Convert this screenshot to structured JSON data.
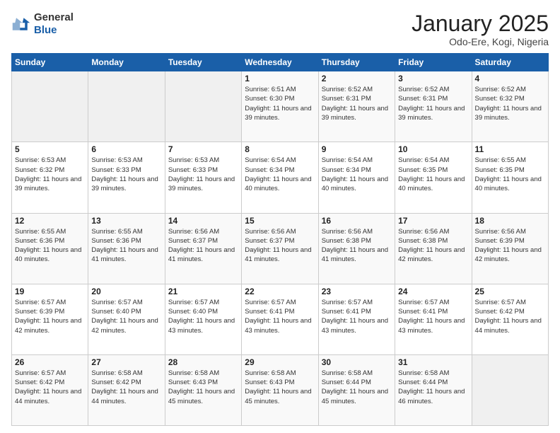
{
  "header": {
    "logo_general": "General",
    "logo_blue": "Blue",
    "month_title": "January 2025",
    "location": "Odo-Ere, Kogi, Nigeria"
  },
  "weekdays": [
    "Sunday",
    "Monday",
    "Tuesday",
    "Wednesday",
    "Thursday",
    "Friday",
    "Saturday"
  ],
  "weeks": [
    [
      {
        "day": "",
        "info": ""
      },
      {
        "day": "",
        "info": ""
      },
      {
        "day": "",
        "info": ""
      },
      {
        "day": "1",
        "info": "Sunrise: 6:51 AM\nSunset: 6:30 PM\nDaylight: 11 hours and 39 minutes."
      },
      {
        "day": "2",
        "info": "Sunrise: 6:52 AM\nSunset: 6:31 PM\nDaylight: 11 hours and 39 minutes."
      },
      {
        "day": "3",
        "info": "Sunrise: 6:52 AM\nSunset: 6:31 PM\nDaylight: 11 hours and 39 minutes."
      },
      {
        "day": "4",
        "info": "Sunrise: 6:52 AM\nSunset: 6:32 PM\nDaylight: 11 hours and 39 minutes."
      }
    ],
    [
      {
        "day": "5",
        "info": "Sunrise: 6:53 AM\nSunset: 6:32 PM\nDaylight: 11 hours and 39 minutes."
      },
      {
        "day": "6",
        "info": "Sunrise: 6:53 AM\nSunset: 6:33 PM\nDaylight: 11 hours and 39 minutes."
      },
      {
        "day": "7",
        "info": "Sunrise: 6:53 AM\nSunset: 6:33 PM\nDaylight: 11 hours and 39 minutes."
      },
      {
        "day": "8",
        "info": "Sunrise: 6:54 AM\nSunset: 6:34 PM\nDaylight: 11 hours and 40 minutes."
      },
      {
        "day": "9",
        "info": "Sunrise: 6:54 AM\nSunset: 6:34 PM\nDaylight: 11 hours and 40 minutes."
      },
      {
        "day": "10",
        "info": "Sunrise: 6:54 AM\nSunset: 6:35 PM\nDaylight: 11 hours and 40 minutes."
      },
      {
        "day": "11",
        "info": "Sunrise: 6:55 AM\nSunset: 6:35 PM\nDaylight: 11 hours and 40 minutes."
      }
    ],
    [
      {
        "day": "12",
        "info": "Sunrise: 6:55 AM\nSunset: 6:36 PM\nDaylight: 11 hours and 40 minutes."
      },
      {
        "day": "13",
        "info": "Sunrise: 6:55 AM\nSunset: 6:36 PM\nDaylight: 11 hours and 41 minutes."
      },
      {
        "day": "14",
        "info": "Sunrise: 6:56 AM\nSunset: 6:37 PM\nDaylight: 11 hours and 41 minutes."
      },
      {
        "day": "15",
        "info": "Sunrise: 6:56 AM\nSunset: 6:37 PM\nDaylight: 11 hours and 41 minutes."
      },
      {
        "day": "16",
        "info": "Sunrise: 6:56 AM\nSunset: 6:38 PM\nDaylight: 11 hours and 41 minutes."
      },
      {
        "day": "17",
        "info": "Sunrise: 6:56 AM\nSunset: 6:38 PM\nDaylight: 11 hours and 42 minutes."
      },
      {
        "day": "18",
        "info": "Sunrise: 6:56 AM\nSunset: 6:39 PM\nDaylight: 11 hours and 42 minutes."
      }
    ],
    [
      {
        "day": "19",
        "info": "Sunrise: 6:57 AM\nSunset: 6:39 PM\nDaylight: 11 hours and 42 minutes."
      },
      {
        "day": "20",
        "info": "Sunrise: 6:57 AM\nSunset: 6:40 PM\nDaylight: 11 hours and 42 minutes."
      },
      {
        "day": "21",
        "info": "Sunrise: 6:57 AM\nSunset: 6:40 PM\nDaylight: 11 hours and 43 minutes."
      },
      {
        "day": "22",
        "info": "Sunrise: 6:57 AM\nSunset: 6:41 PM\nDaylight: 11 hours and 43 minutes."
      },
      {
        "day": "23",
        "info": "Sunrise: 6:57 AM\nSunset: 6:41 PM\nDaylight: 11 hours and 43 minutes."
      },
      {
        "day": "24",
        "info": "Sunrise: 6:57 AM\nSunset: 6:41 PM\nDaylight: 11 hours and 43 minutes."
      },
      {
        "day": "25",
        "info": "Sunrise: 6:57 AM\nSunset: 6:42 PM\nDaylight: 11 hours and 44 minutes."
      }
    ],
    [
      {
        "day": "26",
        "info": "Sunrise: 6:57 AM\nSunset: 6:42 PM\nDaylight: 11 hours and 44 minutes."
      },
      {
        "day": "27",
        "info": "Sunrise: 6:58 AM\nSunset: 6:42 PM\nDaylight: 11 hours and 44 minutes."
      },
      {
        "day": "28",
        "info": "Sunrise: 6:58 AM\nSunset: 6:43 PM\nDaylight: 11 hours and 45 minutes."
      },
      {
        "day": "29",
        "info": "Sunrise: 6:58 AM\nSunset: 6:43 PM\nDaylight: 11 hours and 45 minutes."
      },
      {
        "day": "30",
        "info": "Sunrise: 6:58 AM\nSunset: 6:44 PM\nDaylight: 11 hours and 45 minutes."
      },
      {
        "day": "31",
        "info": "Sunrise: 6:58 AM\nSunset: 6:44 PM\nDaylight: 11 hours and 46 minutes."
      },
      {
        "day": "",
        "info": ""
      }
    ]
  ]
}
